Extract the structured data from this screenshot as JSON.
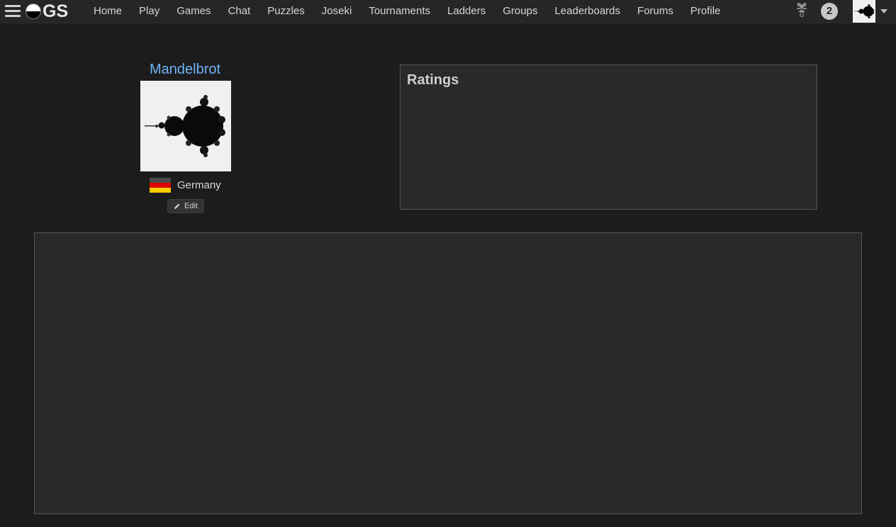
{
  "app": {
    "logo_text": "GS",
    "icons": {
      "menu": "hamburger-menu-icon",
      "logo": "go-stone-logo-icon",
      "friends": "friends-icon",
      "edit": "pencil-icon",
      "caret": "caret-down-icon"
    }
  },
  "nav": {
    "links": [
      "Home",
      "Play",
      "Games",
      "Chat",
      "Puzzles",
      "Joseki",
      "Tournaments",
      "Ladders",
      "Groups",
      "Leaderboards",
      "Forums",
      "Profile"
    ],
    "friends_count": "0",
    "notification_count": "2"
  },
  "profile": {
    "username": "Mandelbrot",
    "avatar": "mandelbrot-fractal-image",
    "country": "Germany",
    "flag_colors": [
      "#000000",
      "#dd0000",
      "#ffcc00"
    ],
    "edit_label": "Edit"
  },
  "ratings": {
    "title": "Ratings"
  },
  "colors": {
    "background": "#1c1c1c",
    "navbar": "#262626",
    "panel": "#292929",
    "link": "#6fb3f7"
  }
}
